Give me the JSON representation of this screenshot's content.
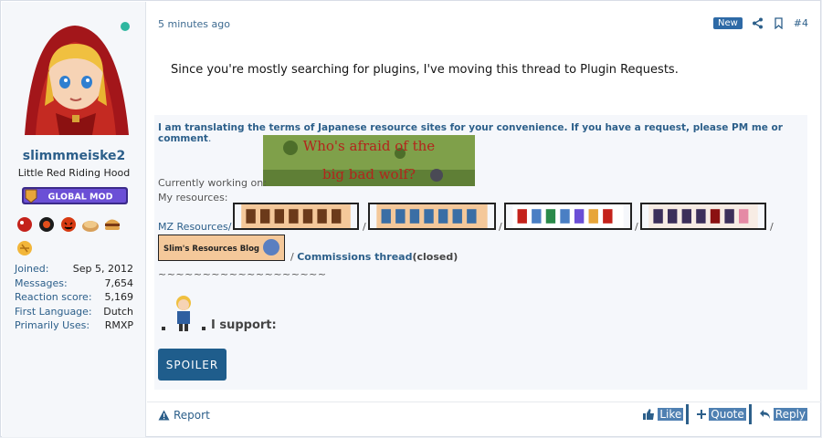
{
  "user": {
    "name": "slimmmeiske2",
    "title": "Little Red Riding Hood",
    "badge": "GLOBAL MOD",
    "online_color": "#2fb7a0",
    "stats": [
      {
        "label": "Joined:",
        "value": "Sep 5, 2012"
      },
      {
        "label": "Messages:",
        "value": "7,654"
      },
      {
        "label": "Reaction score:",
        "value": "5,169"
      },
      {
        "label": "First Language:",
        "value": "Dutch"
      },
      {
        "label": "Primarily Uses:",
        "value": "RMXP"
      }
    ]
  },
  "post": {
    "time": "5 minutes ago",
    "new_label": "New",
    "number": "#4",
    "message": "Since you're mostly searching for plugins, I've moving this thread to Plugin Requests."
  },
  "signature": {
    "translating": "I am translating the terms of Japanese resource sites for your convenience. If you have a request, please PM me or comment",
    "translating_end": ".",
    "banner_wolf_line1": "Who's afraid of the",
    "banner_wolf_line2": "big bad wolf?",
    "working_label": "Currently working on:",
    "resources_label": "My resources:",
    "mz_label": "MZ Resources/",
    "slash": "/",
    "blog_label": "Slim's Resources Blog",
    "commissions": "Commissions thread",
    "closed": "(closed)",
    "tilde": "~~~~~~~~~~~~~~~~~~~",
    "support_label": "I support:",
    "spoiler": "SPOILER"
  },
  "footer": {
    "report": "Report",
    "like": "Like",
    "quote": "Quote",
    "reply": "Reply"
  },
  "colors": {
    "link": "#2c5f8a",
    "spoiler_bg": "#1f5d8c",
    "new_badge": "#2e6aa6"
  }
}
